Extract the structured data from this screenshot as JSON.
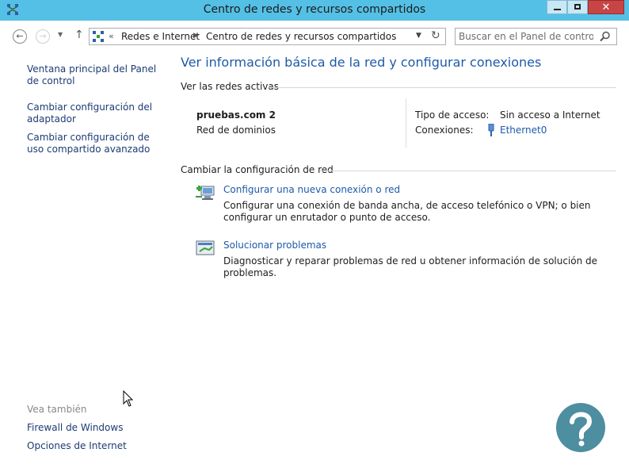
{
  "window": {
    "title": "Centro de redes y recursos compartidos",
    "controls": {
      "minimize": "minimize-icon",
      "maximize": "maximize-icon",
      "close": "✕"
    }
  },
  "navbar": {
    "breadcrumb_sep": "«",
    "crumbs": [
      "Redes e Internet",
      "Centro de redes y recursos compartidos"
    ],
    "search_placeholder": "Buscar en el Panel de control"
  },
  "sidebar": {
    "links": [
      "Ventana principal del Panel de control",
      "Cambiar configuración del adaptador",
      "Cambiar configuración de uso compartido avanzado"
    ],
    "see_also_label": "Vea también",
    "see_also": [
      "Firewall de Windows",
      "Opciones de Internet"
    ]
  },
  "main": {
    "title": "Ver información básica de la red y configurar conexiones",
    "active_networks_header": "Ver las redes activas",
    "network": {
      "name": "pruebas.com  2",
      "type": "Red de dominios",
      "access_label": "Tipo de acceso:",
      "access_value": "Sin acceso a Internet",
      "connections_label": "Conexiones:",
      "connection_value": "Ethernet0"
    },
    "change_header": "Cambiar la configuración de red",
    "tasks": [
      {
        "link": "Configurar una nueva conexión o red",
        "description": "Configurar una conexión de banda ancha, de acceso telefónico o VPN; o bien configurar un enrutador o punto de acceso."
      },
      {
        "link": "Solucionar problemas",
        "description": "Diagnosticar y reparar problemas de red u obtener información de solución de problemas."
      }
    ]
  },
  "colors": {
    "titlebar": "#55c0e6",
    "link": "#1e5aa8",
    "sidebar_link": "#1c3b74",
    "help_watermark": "#4d8ea0"
  }
}
